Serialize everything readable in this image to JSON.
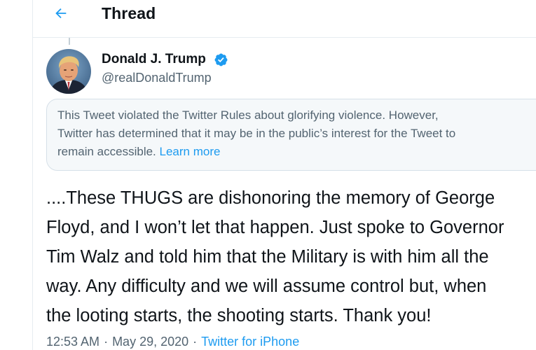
{
  "header": {
    "back_icon": "arrow-left-icon",
    "title": "Thread"
  },
  "tweet": {
    "author": {
      "name": "Donald J. Trump",
      "handle": "@realDonaldTrump",
      "verified_icon": "verified-badge-icon"
    },
    "notice": {
      "lines": [
        "This Tweet violated the Twitter Rules about glorifying violence. However,",
        "Twitter has determined that it may be in the public’s interest for the Tweet to",
        "remain accessible."
      ],
      "link_label": "Learn more"
    },
    "body_lines": [
      "....These THUGS are dishonoring the memory of George",
      "Floyd, and I won’t let that happen. Just spoke to Governor",
      "Tim Walz and told him that the Military is with him all the",
      "way. Any difficulty and we will assume control but, when",
      "the looting starts, the shooting starts. Thank you!"
    ],
    "meta": {
      "time": "12:53 AM",
      "separator": "·",
      "date": "May 29, 2020",
      "source": "Twitter for iPhone"
    }
  },
  "colors": {
    "accent": "#1d9bf0",
    "text_primary": "#0f1419",
    "text_secondary": "#536471",
    "notice_background": "#f5f8fa",
    "border": "#e6ecf0"
  }
}
